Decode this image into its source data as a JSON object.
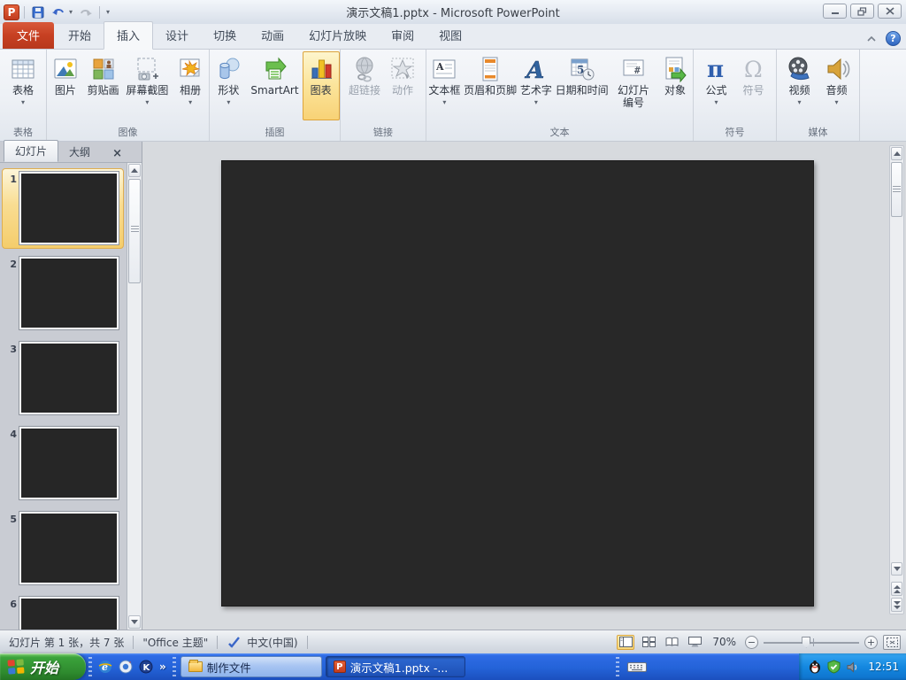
{
  "window": {
    "title": "演示文稿1.pptx  -  Microsoft PowerPoint"
  },
  "ui": {
    "dropdown_glyph": "▾",
    "close_glyph": "×",
    "help_glyph": "?",
    "app_initial": "P",
    "more_glyph": "»"
  },
  "tabs": {
    "file": {
      "label": "文件"
    },
    "items": [
      {
        "label": "开始"
      },
      {
        "label": "插入",
        "active": true
      },
      {
        "label": "设计"
      },
      {
        "label": "切换"
      },
      {
        "label": "动画"
      },
      {
        "label": "幻灯片放映"
      },
      {
        "label": "审阅"
      },
      {
        "label": "视图"
      }
    ]
  },
  "ribbon": {
    "groups": [
      {
        "name": "表格",
        "buttons": [
          {
            "label": "表格",
            "dropdown": true
          }
        ]
      },
      {
        "name": "图像",
        "buttons": [
          {
            "label": "图片"
          },
          {
            "label": "剪贴画"
          },
          {
            "label": "屏幕截图",
            "dropdown": true
          },
          {
            "label": "相册",
            "dropdown": true
          }
        ]
      },
      {
        "name": "插图",
        "buttons": [
          {
            "label": "形状",
            "dropdown": true
          },
          {
            "label": "SmartArt"
          },
          {
            "label": "图表",
            "highlighted": true
          }
        ]
      },
      {
        "name": "链接",
        "buttons": [
          {
            "label": "超链接",
            "disabled": true
          },
          {
            "label": "动作",
            "disabled": true
          }
        ]
      },
      {
        "name": "文本",
        "buttons": [
          {
            "label": "文本框",
            "dropdown": true
          },
          {
            "label": "页眉和页脚"
          },
          {
            "label": "艺术字",
            "dropdown": true
          },
          {
            "label": "日期和时间"
          },
          {
            "label": "幻灯片编号",
            "line1": "幻灯片",
            "line2": "编号"
          },
          {
            "label": "对象"
          }
        ]
      },
      {
        "name": "符号",
        "buttons": [
          {
            "label": "公式",
            "dropdown": true
          },
          {
            "label": "符号",
            "disabled": true
          }
        ]
      },
      {
        "name": "媒体",
        "buttons": [
          {
            "label": "视频",
            "dropdown": true
          },
          {
            "label": "音频",
            "dropdown": true
          }
        ]
      }
    ]
  },
  "slide_panel": {
    "tabs": [
      {
        "label": "幻灯片",
        "active": true
      },
      {
        "label": "大纲"
      }
    ],
    "slides": [
      {
        "number": "1",
        "selected": true
      },
      {
        "number": "2"
      },
      {
        "number": "3"
      },
      {
        "number": "4"
      },
      {
        "number": "5"
      },
      {
        "number": "6"
      }
    ]
  },
  "status_bar": {
    "slide_info": "幻灯片 第 1 张，共 7 张",
    "theme": "\"Office 主题\"",
    "language": "中文(中国)",
    "zoom": "70%",
    "zoom_out": "−",
    "zoom_in": "+"
  },
  "taskbar": {
    "start_label": "开始",
    "buttons": [
      {
        "label": "制作文件"
      },
      {
        "label": "演示文稿1.pptx -..."
      }
    ],
    "time": "12:51"
  }
}
